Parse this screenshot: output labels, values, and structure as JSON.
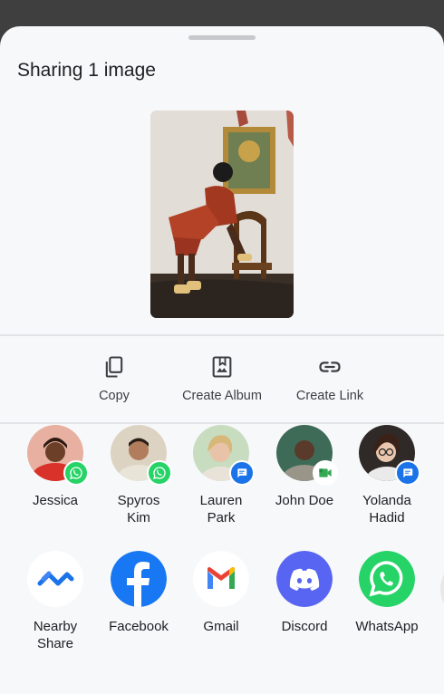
{
  "sheet": {
    "title": "Sharing 1 image"
  },
  "actions": [
    {
      "label": "Copy",
      "icon": "copy-icon"
    },
    {
      "label": "Create Album",
      "icon": "album-icon"
    },
    {
      "label": "Create Link",
      "icon": "link-icon"
    }
  ],
  "people": [
    {
      "name": "Jessica",
      "badge": "whatsapp-icon"
    },
    {
      "name": "Spyros\nKim",
      "badge": "whatsapp-icon"
    },
    {
      "name": "Lauren\nPark",
      "badge": "messages-icon"
    },
    {
      "name": "John Doe",
      "badge": "meet-icon"
    },
    {
      "name": "Yolanda\nHadid",
      "badge": "messages-icon"
    }
  ],
  "apps": [
    {
      "name": "Nearby\nShare",
      "icon": "nearby-share-icon"
    },
    {
      "name": "Facebook",
      "icon": "facebook-icon"
    },
    {
      "name": "Gmail",
      "icon": "gmail-icon"
    },
    {
      "name": "Discord",
      "icon": "discord-icon"
    },
    {
      "name": "WhatsApp",
      "icon": "whatsapp-icon"
    }
  ],
  "colors": {
    "whatsapp": "#25d366",
    "messages": "#1a73e8",
    "meet": "#34a853",
    "facebook": "#1877f2",
    "discord": "#5865f2"
  }
}
